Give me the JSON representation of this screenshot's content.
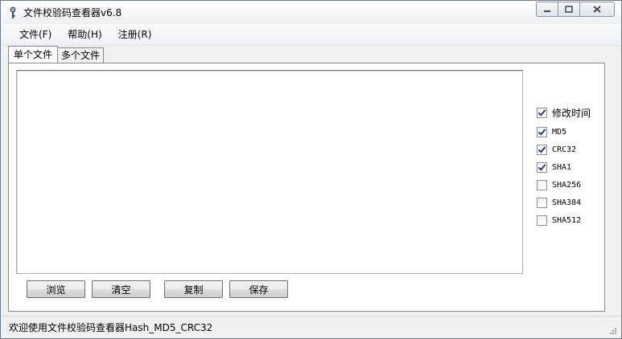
{
  "window": {
    "title": "文件校验码查看器v6.8"
  },
  "menu": [
    {
      "label": "文件(F)"
    },
    {
      "label": "帮助(H)"
    },
    {
      "label": "注册(R)"
    }
  ],
  "tabs": [
    {
      "label": "单个文件",
      "active": true
    },
    {
      "label": "多个文件",
      "active": false
    }
  ],
  "options": [
    {
      "label": "修改时间",
      "checked": true
    },
    {
      "label": "MD5",
      "checked": true
    },
    {
      "label": "CRC32",
      "checked": true
    },
    {
      "label": "SHA1",
      "checked": true
    },
    {
      "label": "SHA256",
      "checked": false
    },
    {
      "label": "SHA384",
      "checked": false
    },
    {
      "label": "SHA512",
      "checked": false
    }
  ],
  "buttons": {
    "browse": "浏览",
    "clear": "清空",
    "copy": "复制",
    "save": "保存"
  },
  "result_text": "",
  "status": "欢迎使用文件校验码查看器Hash_MD5_CRC32"
}
